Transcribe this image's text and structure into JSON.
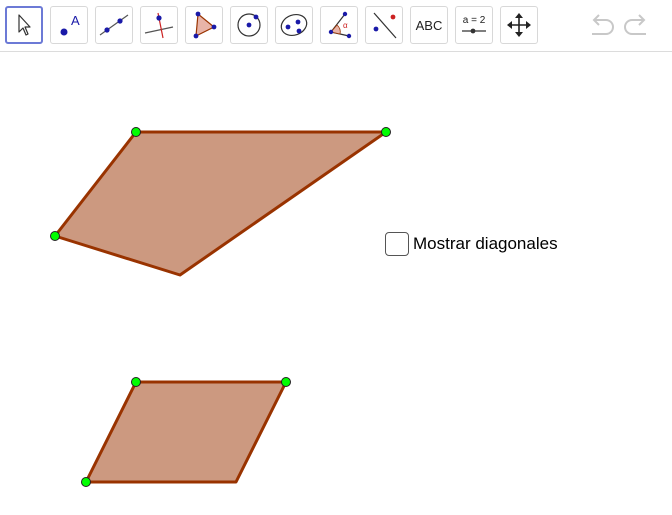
{
  "toolbar": {
    "tools": [
      {
        "name": "move-tool",
        "icon": "arrow-pointer-icon",
        "selected": true
      },
      {
        "name": "point-tool",
        "icon": "point-icon",
        "label": "A"
      },
      {
        "name": "line-tool",
        "icon": "line-through-points-icon"
      },
      {
        "name": "perpendicular-line-tool",
        "icon": "perpendicular-line-icon"
      },
      {
        "name": "polygon-tool",
        "icon": "polygon-icon"
      },
      {
        "name": "circle-tool",
        "icon": "circle-center-point-icon"
      },
      {
        "name": "conic-tool",
        "icon": "ellipse-icon"
      },
      {
        "name": "angle-tool",
        "icon": "angle-icon",
        "label": "α"
      },
      {
        "name": "reflect-tool",
        "icon": "reflect-about-line-icon"
      },
      {
        "name": "text-tool",
        "icon": "text-icon",
        "label": "ABC"
      },
      {
        "name": "slider-tool",
        "icon": "slider-icon",
        "label": "a = 2"
      },
      {
        "name": "move-graphics-view-tool",
        "icon": "move-arrows-icon"
      }
    ],
    "undo_icon": "undo-icon",
    "redo_icon": "redo-icon"
  },
  "checkbox": {
    "label": "Mostrar diagonales",
    "checked": false
  },
  "colors": {
    "polygon_fill": "#cc9980",
    "polygon_stroke": "#993300",
    "point_fill": "#00ff00",
    "toolbar_selected_border": "#6c7ad6",
    "point_blue": "#1a1aa8"
  }
}
